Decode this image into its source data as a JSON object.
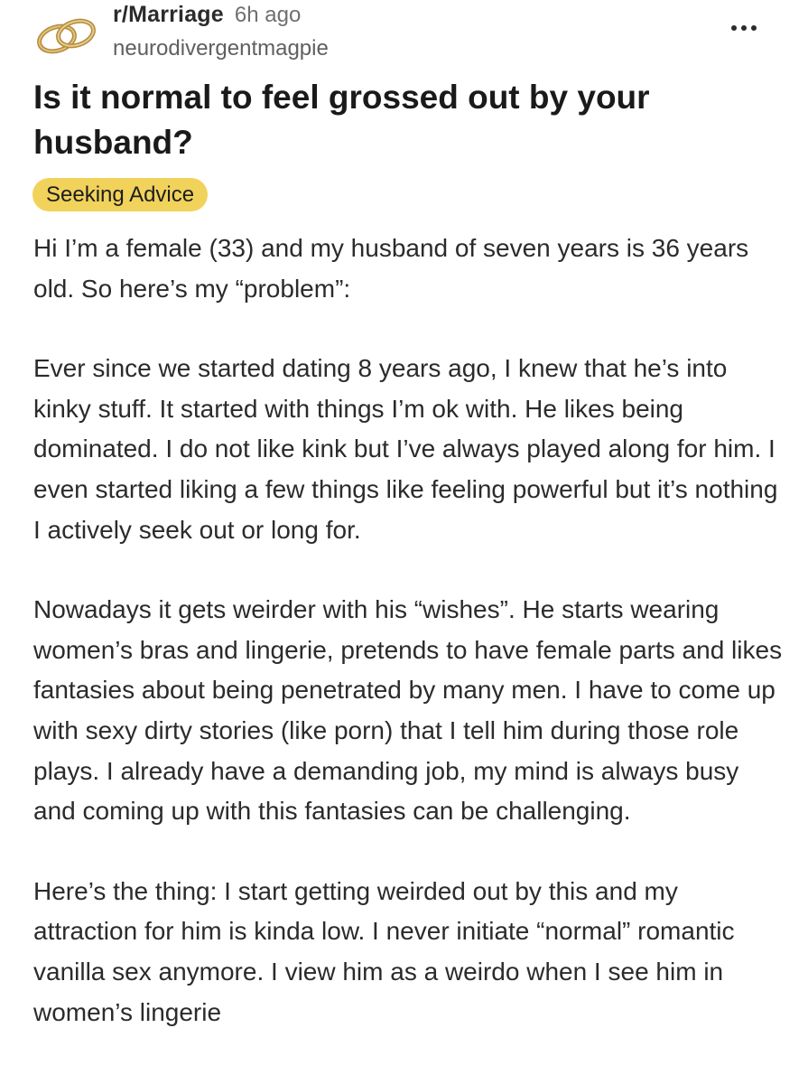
{
  "post": {
    "subreddit": "r/Marriage",
    "time_ago": "6h ago",
    "author": "neurodivergentmagpie",
    "more_icon": "ellipsis-icon",
    "avatar_icon": "wedding-rings-icon",
    "title": "Is it normal to feel grossed out by your husband?",
    "flair": "Seeking Advice",
    "flair_color": "#f1d25b",
    "paragraphs": [
      "Hi I’m a female (33) and my husband of seven years is 36 years old. So here’s my “problem”:",
      "Ever since we started dating 8 years ago, I knew that he’s into kinky stuff. It started with things I’m ok with. He likes being dominated. I do not like kink but I’ve always played along for him. I even started liking a few things like feeling powerful but it’s nothing I actively seek out or long for.",
      "Nowadays it gets weirder with his “wishes”. He starts wearing women’s bras and lingerie, pretends to have female parts and likes fantasies about being penetrated by many men. I have to come up with sexy dirty stories (like porn) that I tell him during those role plays. I already have a demanding job, my mind is always busy and coming up with this fantasies can be challenging.",
      "Here’s the thing: I start getting weirded out by this and my attraction for him is kinda low. I never initiate “normal” romantic vanilla sex anymore. I view him as a weirdo when I see him in women’s lingerie"
    ]
  }
}
